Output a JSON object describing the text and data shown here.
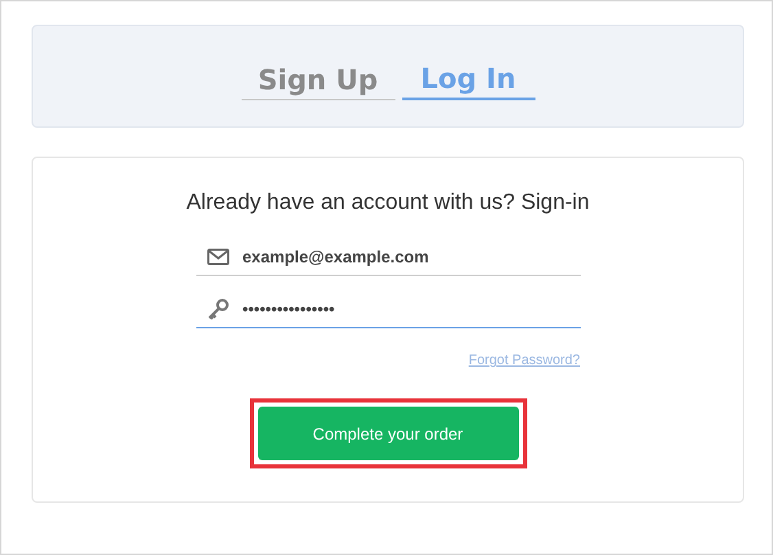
{
  "tabs": [
    {
      "label": "Sign Up",
      "selected": false
    },
    {
      "label": "Log In",
      "selected": true
    }
  ],
  "heading": "Already have an account with us? Sign-in",
  "fields": [
    {
      "kind": "email",
      "value": "example@example.com",
      "focused": false
    },
    {
      "kind": "password",
      "value": "••••••••••••••••",
      "focused": true
    }
  ],
  "forgot_link": "Forgot Password?",
  "submit": {
    "label": "Complete your order",
    "highlighted": true
  }
}
